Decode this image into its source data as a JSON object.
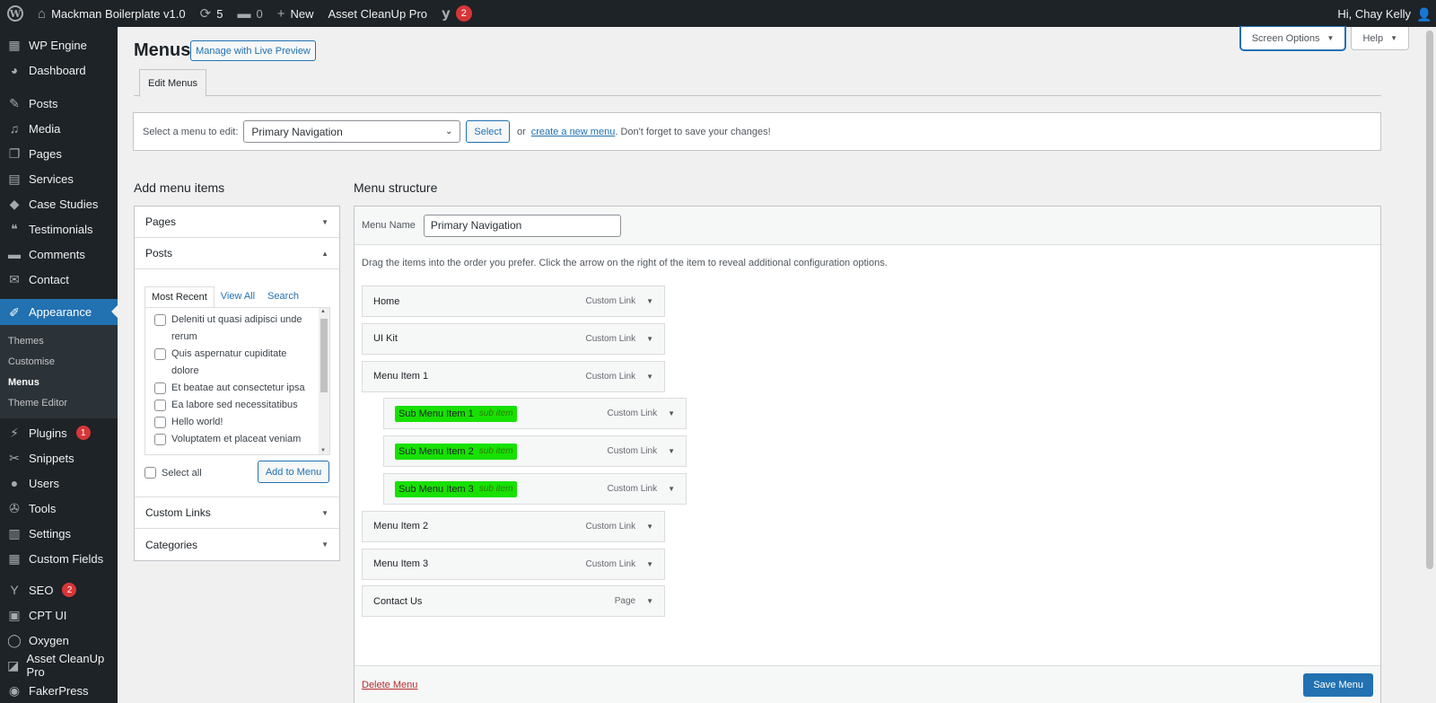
{
  "adminbar": {
    "site_name": "Mackman Boilerplate v1.0",
    "updates_count": "5",
    "comments_count": "0",
    "new_label": "New",
    "asset_cleanup": "Asset CleanUp Pro",
    "yoast_badge": "2",
    "greeting": "Hi, Chay Kelly"
  },
  "sidebar": {
    "items_top": [
      {
        "label": "WP Engine",
        "icon": "wp-engine-icon",
        "glyph": "▦"
      },
      {
        "label": "Dashboard",
        "icon": "dashboard-icon",
        "glyph": "◕"
      }
    ],
    "items_mid": [
      {
        "label": "Posts",
        "icon": "pin-icon",
        "glyph": "✎"
      },
      {
        "label": "Media",
        "icon": "media-icon",
        "glyph": "♫"
      },
      {
        "label": "Pages",
        "icon": "pages-icon",
        "glyph": "❐"
      },
      {
        "label": "Services",
        "icon": "services-icon",
        "glyph": "▤"
      },
      {
        "label": "Case Studies",
        "icon": "case-studies-icon",
        "glyph": "◆"
      },
      {
        "label": "Testimonials",
        "icon": "testimonials-icon",
        "glyph": "❝"
      },
      {
        "label": "Comments",
        "icon": "comments-icon",
        "glyph": "▬"
      },
      {
        "label": "Contact",
        "icon": "contact-icon",
        "glyph": "✉"
      }
    ],
    "appearance": {
      "label": "Appearance",
      "icon": "appearance-icon",
      "glyph": "✐"
    },
    "appearance_sub": [
      "Themes",
      "Customise",
      "Menus",
      "Theme Editor"
    ],
    "items_bottom": [
      {
        "label": "Plugins",
        "icon": "plugins-icon",
        "glyph": "⚡",
        "badge": "1"
      },
      {
        "label": "Snippets",
        "icon": "snippets-icon",
        "glyph": "✂"
      },
      {
        "label": "Users",
        "icon": "users-icon",
        "glyph": "●"
      },
      {
        "label": "Tools",
        "icon": "tools-icon",
        "glyph": "✇"
      },
      {
        "label": "Settings",
        "icon": "settings-icon",
        "glyph": "▥"
      },
      {
        "label": "Custom Fields",
        "icon": "custom-fields-icon",
        "glyph": "▦"
      }
    ],
    "items_plugins": [
      {
        "label": "SEO",
        "icon": "yoast-icon",
        "glyph": "Y",
        "badge": "2"
      },
      {
        "label": "CPT UI",
        "icon": "cpt-ui-icon",
        "glyph": "▣"
      },
      {
        "label": "Oxygen",
        "icon": "oxygen-icon",
        "glyph": "◯"
      },
      {
        "label": "Asset CleanUp Pro",
        "icon": "asset-cleanup-icon",
        "glyph": "◪"
      },
      {
        "label": "FakerPress",
        "icon": "fakerpress-icon",
        "glyph": "◉"
      }
    ]
  },
  "header": {
    "title": "Menus",
    "live_preview_button": "Manage with Live Preview",
    "screen_options": "Screen Options",
    "help": "Help",
    "tab_edit_menus": "Edit Menus"
  },
  "manage": {
    "label": "Select a menu to edit:",
    "selected": "Primary Navigation",
    "select_button": "Select",
    "or_text": "or",
    "create_link": "create a new menu",
    "suffix": ". Don't forget to save your changes!"
  },
  "add_items": {
    "title": "Add menu items",
    "pages": "Pages",
    "posts": "Posts",
    "tabs": [
      "Most Recent",
      "View All",
      "Search"
    ],
    "posts_list": [
      "Deleniti ut quasi adipisci unde rerum",
      "Quis aspernatur cupiditate dolore",
      "Et beatae aut consectetur ipsa",
      "Ea labore sed necessitatibus",
      "Hello world!",
      "Voluptatem et placeat veniam"
    ],
    "select_all": "Select all",
    "add_button": "Add to Menu",
    "custom_links": "Custom Links",
    "categories": "Categories"
  },
  "structure": {
    "title": "Menu structure",
    "name_label": "Menu Name",
    "name_value": "Primary Navigation",
    "instructions": "Drag the items into the order you prefer. Click the arrow on the right of the item to reveal additional configuration options.",
    "items": [
      {
        "title": "Home",
        "type": "Custom Link",
        "sub": false
      },
      {
        "title": "UI Kit",
        "type": "Custom Link",
        "sub": false
      },
      {
        "title": "Menu Item 1",
        "type": "Custom Link",
        "sub": false
      },
      {
        "title": "Sub Menu Item 1",
        "type": "Custom Link",
        "sub": true,
        "tag": "sub item"
      },
      {
        "title": "Sub Menu Item 2",
        "type": "Custom Link",
        "sub": true,
        "tag": "sub item"
      },
      {
        "title": "Sub Menu Item 3",
        "type": "Custom Link",
        "sub": true,
        "tag": "sub item"
      },
      {
        "title": "Menu Item 2",
        "type": "Custom Link",
        "sub": false
      },
      {
        "title": "Menu Item 3",
        "type": "Custom Link",
        "sub": false
      },
      {
        "title": "Contact Us",
        "type": "Page",
        "sub": false
      }
    ],
    "delete_link": "Delete Menu",
    "save_button": "Save Menu"
  },
  "colors": {
    "accent": "#2271b1",
    "highlight": "#17e100",
    "sidebar_bg": "#1d2327",
    "danger": "#d63638"
  }
}
